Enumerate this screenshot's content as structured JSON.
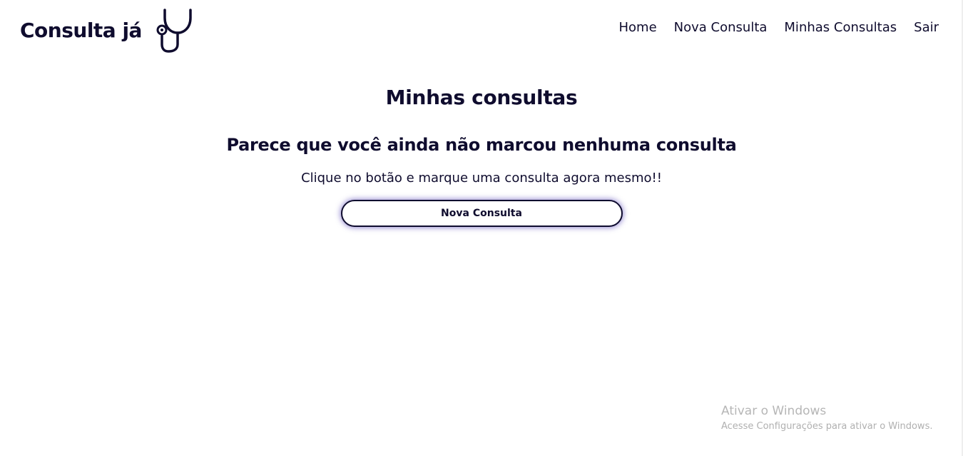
{
  "header": {
    "brand_name": "Consulta já",
    "brand_icon": "stethoscope-icon",
    "nav": {
      "home": "Home",
      "new_appointment": "Nova Consulta",
      "my_appointments": "Minhas Consultas",
      "logout": "Sair"
    }
  },
  "main": {
    "title": "Minhas consultas",
    "empty_heading": "Parece que você ainda não marcou nenhuma consulta",
    "empty_text": "Clique no botão e marque uma consulta agora mesmo!!",
    "cta_label": "Nova Consulta"
  },
  "watermark": {
    "title": "Ativar o Windows",
    "subtitle": "Acesse Configurações para ativar o Windows."
  },
  "colors": {
    "text": "#0f0c2e",
    "background": "#ffffff",
    "button_glow": "#3c28aa",
    "watermark": "#b6b6b6"
  }
}
